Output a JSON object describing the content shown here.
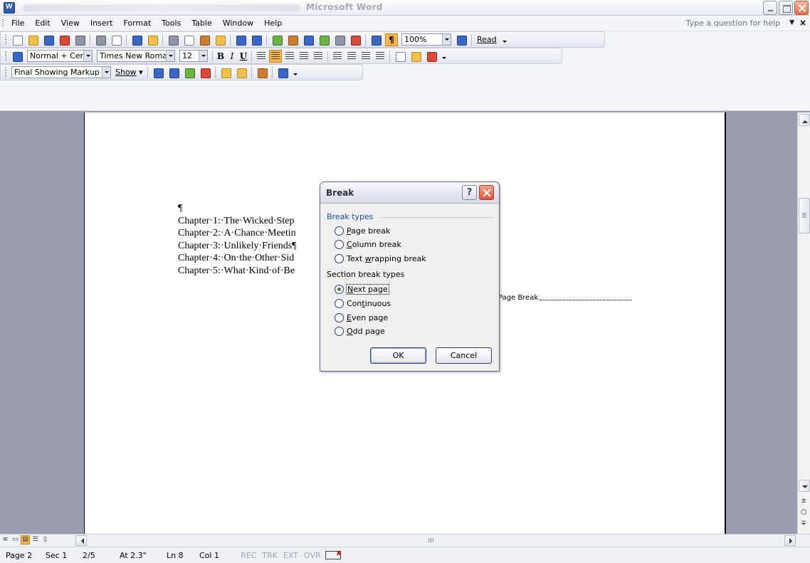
{
  "window": {
    "title": "Microsoft Word"
  },
  "menu": {
    "items": [
      "File",
      "Edit",
      "View",
      "Insert",
      "Format",
      "Tools",
      "Table",
      "Window",
      "Help"
    ],
    "help_placeholder": "Type a question for help"
  },
  "toolbar_standard": {
    "zoom": "100%",
    "read_label": "Read"
  },
  "toolbar_formatting": {
    "style": "Normal + Cent",
    "font": "Times New Roman",
    "size": "12"
  },
  "toolbar_reviewing": {
    "display_mode": "Final Showing Markup",
    "show_label": "Show"
  },
  "document": {
    "pilcrow": "¶",
    "lines": [
      "Chapter·1:·The·Wicked·Step",
      "Chapter·2:·A·Chance·Meetin",
      "Chapter·3:·Unlikely·Friends¶",
      "Chapter·4:·On·the·Other·Sid",
      "Chapter·5:·What·Kind·of·Be"
    ],
    "page_break_label": "Page Break"
  },
  "dialog": {
    "title": "Break",
    "help_glyph": "?",
    "group1": "Break types",
    "options1": [
      "Page break",
      "Column break",
      "Text wrapping break"
    ],
    "group2": "Section break types",
    "options2": [
      "Next page",
      "Continuous",
      "Even page",
      "Odd page"
    ],
    "selected": "Next page",
    "ok": "OK",
    "cancel": "Cancel"
  },
  "status": {
    "page": "Page 2",
    "sec": "Sec 1",
    "pages": "2/5",
    "at": "At 2.3\"",
    "ln": "Ln 8",
    "col": "Col 1",
    "modes": [
      "REC",
      "TRK",
      "EXT",
      "OVR"
    ]
  },
  "icons": {
    "toolbar1": [
      "new-document-icon",
      "open-icon",
      "save-icon",
      "permission-icon",
      "email-icon",
      "print-icon",
      "print-preview-icon",
      "spelling-icon",
      "research-icon",
      "cut-icon",
      "copy-icon",
      "paste-icon",
      "format-painter-icon",
      "undo-icon",
      "redo-icon",
      "hyperlink-icon",
      "tables-borders-icon",
      "insert-table-icon",
      "insert-excel-icon",
      "columns-icon",
      "drawing-icon",
      "document-map-icon",
      "show-hide-icon",
      "help-icon"
    ],
    "accent": "#f6b64e"
  }
}
